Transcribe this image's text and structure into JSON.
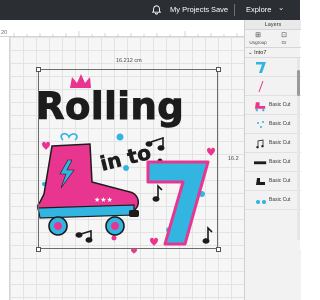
{
  "topbar": {
    "my_projects": "My Projects",
    "save": "Save",
    "explore": "Explore",
    "explore_chevron": "⌄"
  },
  "rulers": {
    "top_ticks": [
      "40",
      "60"
    ],
    "left_tick": "20"
  },
  "canvas": {
    "width_label": "16.212 cm",
    "height_label": "16.2"
  },
  "design": {
    "title_word": "Rolling",
    "sub_word": "in to",
    "number": "7",
    "colors": {
      "pink": "#e8358f",
      "blue": "#33b5e2",
      "black": "#1c1c1c",
      "yellow": "#f2c230"
    }
  },
  "layers_panel": {
    "title": "Layers",
    "tools": [
      {
        "label": "Ungroup",
        "icon": "ungroup-icon"
      },
      {
        "label": "Gr",
        "icon": "group-icon"
      }
    ],
    "group_name": "Into7",
    "items": [
      {
        "label": "",
        "thumb": "7"
      },
      {
        "label": "",
        "thumb": "/"
      },
      {
        "label": "Basic Cut",
        "thumb": "skate"
      },
      {
        "label": "Basic Cut",
        "thumb": "dots"
      },
      {
        "label": "Basic Cut",
        "thumb": "notes"
      },
      {
        "label": "Basic Cut",
        "thumb": "rolling"
      },
      {
        "label": "Basic Cut",
        "thumb": "skate-small"
      },
      {
        "label": "Basic Cut",
        "thumb": "wheels"
      }
    ]
  }
}
